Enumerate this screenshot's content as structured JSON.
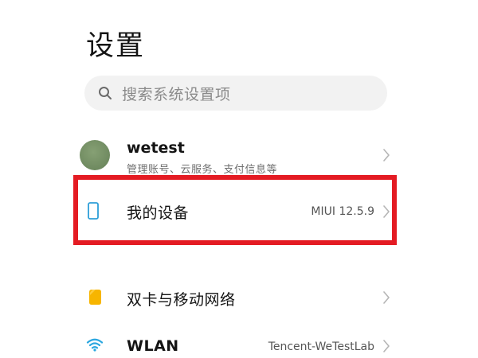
{
  "header": {
    "title": "设置"
  },
  "search": {
    "placeholder": "搜索系统设置项"
  },
  "account": {
    "name": "wetest",
    "subtitle": "管理账号、云服务、支付信息等"
  },
  "items": [
    {
      "label": "我的设备",
      "value": "MIUI 12.5.9",
      "icon": "phone-icon"
    },
    {
      "label": "双卡与移动网络",
      "value": "",
      "icon": "sim-card-icon"
    },
    {
      "label": "WLAN",
      "value": "Tencent-WeTestLab",
      "icon": "wifi-icon"
    }
  ],
  "colors": {
    "highlight": "#e41b23",
    "device_icon": "#2e9fd8",
    "sim_icon": "#f7b500",
    "wifi_icon": "#2ba7e0"
  }
}
